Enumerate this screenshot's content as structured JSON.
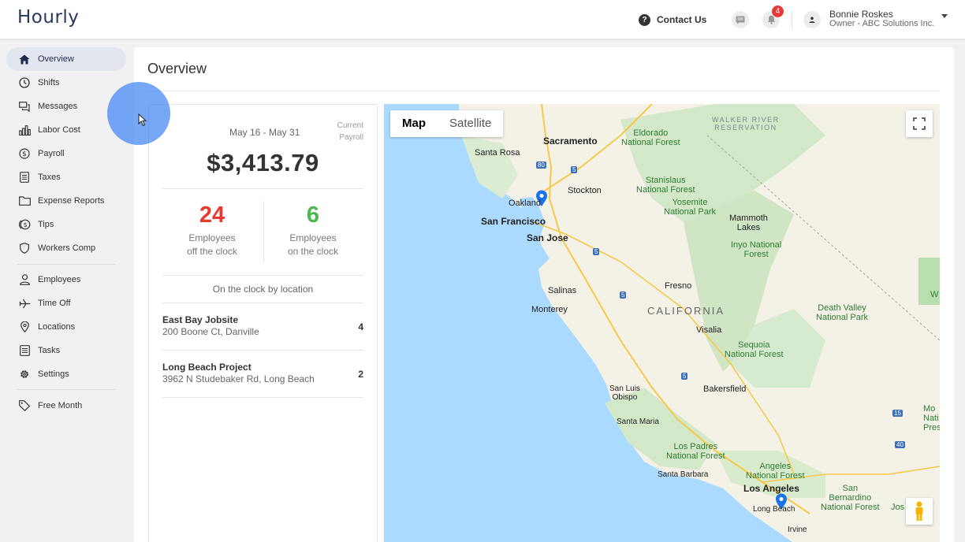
{
  "app": {
    "logo": "Hourly"
  },
  "header": {
    "contact_label": "Contact Us",
    "notifications_count": "4",
    "user_name": "Bonnie Roskes",
    "user_role": "Owner - ABC Solutions Inc."
  },
  "sidebar": {
    "items": [
      {
        "label": "Overview",
        "icon": "home-icon",
        "active": true
      },
      {
        "label": "Shifts",
        "icon": "clock-icon"
      },
      {
        "label": "Messages",
        "icon": "messages-icon"
      },
      {
        "label": "Labor Cost",
        "icon": "bar-chart-icon"
      },
      {
        "label": "Payroll",
        "icon": "dollar-circle-icon"
      },
      {
        "label": "Taxes",
        "icon": "document-icon"
      },
      {
        "label": "Expense Reports",
        "icon": "folder-icon"
      },
      {
        "label": "Tips",
        "icon": "coin-icon"
      },
      {
        "label": "Workers Comp",
        "icon": "shield-icon"
      },
      {
        "label": "Employees",
        "icon": "person-icon"
      },
      {
        "label": "Time Off",
        "icon": "airplane-icon"
      },
      {
        "label": "Locations",
        "icon": "location-pin-icon"
      },
      {
        "label": "Tasks",
        "icon": "list-icon"
      },
      {
        "label": "Settings",
        "icon": "gear-icon"
      },
      {
        "label": "Free Month",
        "icon": "tag-icon"
      }
    ]
  },
  "main": {
    "title": "Overview",
    "summary": {
      "date_range": "May 16 - May 31",
      "period_line1": "Current",
      "period_line2": "Payroll",
      "amount": "$3,413.79",
      "off_clock_count": "24",
      "off_clock_label1": "Employees",
      "off_clock_label2": "off the clock",
      "on_clock_count": "6",
      "on_clock_label1": "Employees",
      "on_clock_label2": "on the clock",
      "by_location_title": "On the clock by location",
      "locations": [
        {
          "name": "East Bay Jobsite",
          "address": "200 Boone Ct, Danville",
          "count": "4"
        },
        {
          "name": "Long Beach Project",
          "address": "3962 N Studebaker Rd, Long Beach",
          "count": "2"
        }
      ]
    },
    "map": {
      "type_map": "Map",
      "type_satellite": "Satellite",
      "labels": {
        "sacramento": "Sacramento",
        "eldorado1": "Eldorado",
        "eldorado2": "National Forest",
        "walker1": "WALKER RIVER",
        "walker2": "RESERVATION",
        "santa_rosa": "Santa Rosa",
        "stockton": "Stockton",
        "stanislaus1": "Stanislaus",
        "stanislaus2": "National Forest",
        "oakland": "Oakland",
        "yosemite1": "Yosemite",
        "yosemite2": "National Park",
        "san_francisco": "San Francisco",
        "mammoth1": "Mammoth",
        "mammoth2": "Lakes",
        "san_jose": "San Jose",
        "inyo1": "Inyo National",
        "inyo2": "Forest",
        "fresno": "Fresno",
        "salinas": "Salinas",
        "monterey": "Monterey",
        "california": "CALIFORNIA",
        "death_valley1": "Death Valley",
        "death_valley2": "National Park",
        "visalia": "Visalia",
        "sequoia1": "Sequoia",
        "sequoia2": "National Forest",
        "bakersfield": "Bakersfield",
        "slo1": "San Luis",
        "slo2": "Obispo",
        "santa_maria": "Santa Maria",
        "los_padres1": "Los Padres",
        "los_padres2": "National Forest",
        "santa_barbara": "Santa Barbara",
        "angeles1": "Angeles",
        "angeles2": "National Forest",
        "los_angeles": "Los Angeles",
        "san_bernardino1": "San",
        "san_bernardino2": "Bernardino",
        "san_bernardino3": "National Forest",
        "long_beach": "Long Beach",
        "irvine": "Irvine",
        "mojave1": "Mo",
        "mojave2": "Nati",
        "mojave3": "Pres",
        "joshua": "Jos",
        "w_edge": "W"
      },
      "shields": [
        "80",
        "5",
        "5",
        "5",
        "5",
        "15",
        "40"
      ]
    }
  },
  "colors": {
    "accent_navy": "#1d2b4d",
    "off_clock": "#e8392e",
    "on_clock": "#4bb84f",
    "notification": "#e53935",
    "pin": "#1a73e8"
  }
}
